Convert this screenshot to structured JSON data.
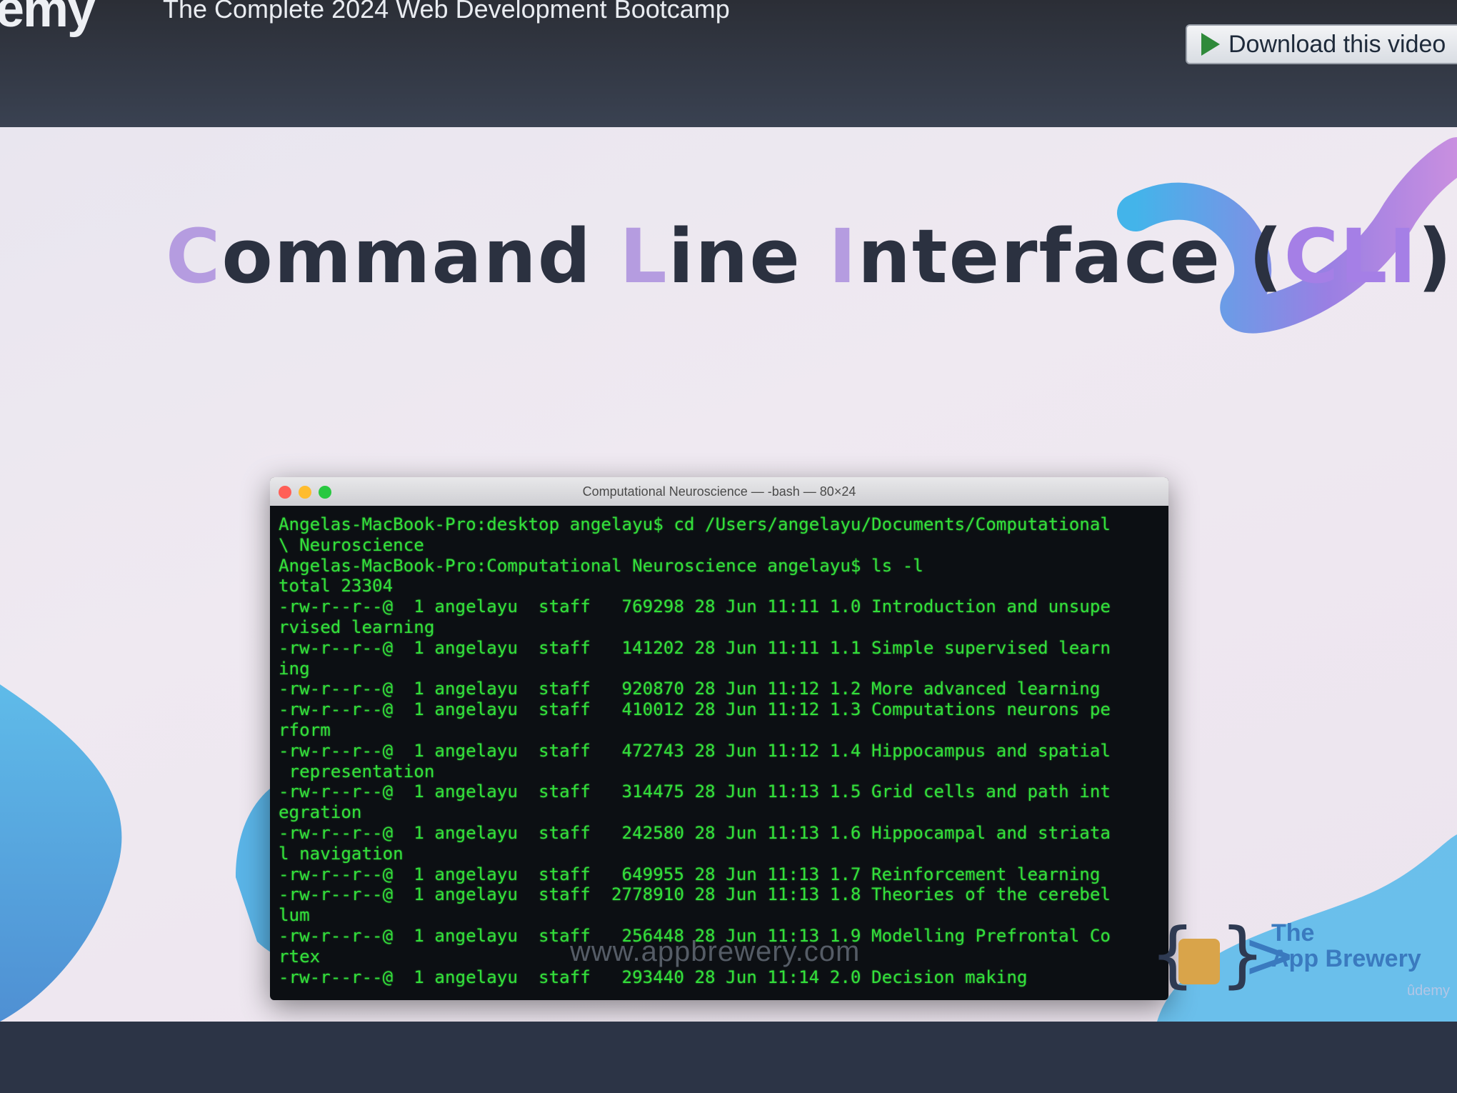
{
  "header": {
    "brand_partial": "emy",
    "course_title": "The Complete 2024 Web Development Bootcamp",
    "download_label": "Download this video"
  },
  "slide": {
    "title_parts": [
      "C",
      "ommand ",
      "L",
      "ine ",
      "I",
      "nterface (",
      "CLI",
      ")"
    ],
    "url": "www.appbrewery.com",
    "logo_text_line1": "The",
    "logo_text_line2": "App Brewery",
    "udemy_watermark": "ûdemy"
  },
  "terminal": {
    "window_title": "Computational Neuroscience — -bash — 80×24",
    "lines": [
      "Angelas-MacBook-Pro:desktop angelayu$ cd /Users/angelayu/Documents/Computational",
      "\\ Neuroscience",
      "Angelas-MacBook-Pro:Computational Neuroscience angelayu$ ls -l",
      "total 23304",
      "-rw-r--r--@  1 angelayu  staff   769298 28 Jun 11:11 1.0 Introduction and unsupe",
      "rvised learning",
      "-rw-r--r--@  1 angelayu  staff   141202 28 Jun 11:11 1.1 Simple supervised learn",
      "ing",
      "-rw-r--r--@  1 angelayu  staff   920870 28 Jun 11:12 1.2 More advanced learning",
      "-rw-r--r--@  1 angelayu  staff   410012 28 Jun 11:12 1.3 Computations neurons pe",
      "rform",
      "-rw-r--r--@  1 angelayu  staff   472743 28 Jun 11:12 1.4 Hippocampus and spatial",
      " representation",
      "-rw-r--r--@  1 angelayu  staff   314475 28 Jun 11:13 1.5 Grid cells and path int",
      "egration",
      "-rw-r--r--@  1 angelayu  staff   242580 28 Jun 11:13 1.6 Hippocampal and striata",
      "l navigation",
      "-rw-r--r--@  1 angelayu  staff   649955 28 Jun 11:13 1.7 Reinforcement learning",
      "-rw-r--r--@  1 angelayu  staff  2778910 28 Jun 11:13 1.8 Theories of the cerebel",
      "lum",
      "-rw-r--r--@  1 angelayu  staff   256448 28 Jun 11:13 1.9 Modelling Prefrontal Co",
      "rtex",
      "-rw-r--r--@  1 angelayu  staff   293440 28 Jun 11:14 2.0 Decision making"
    ]
  },
  "colors": {
    "terminal_text": "#33e03a",
    "title_accent": "#b59ce0",
    "close": "#ff5f57",
    "minimize": "#febc2e",
    "zoom": "#28c840"
  }
}
